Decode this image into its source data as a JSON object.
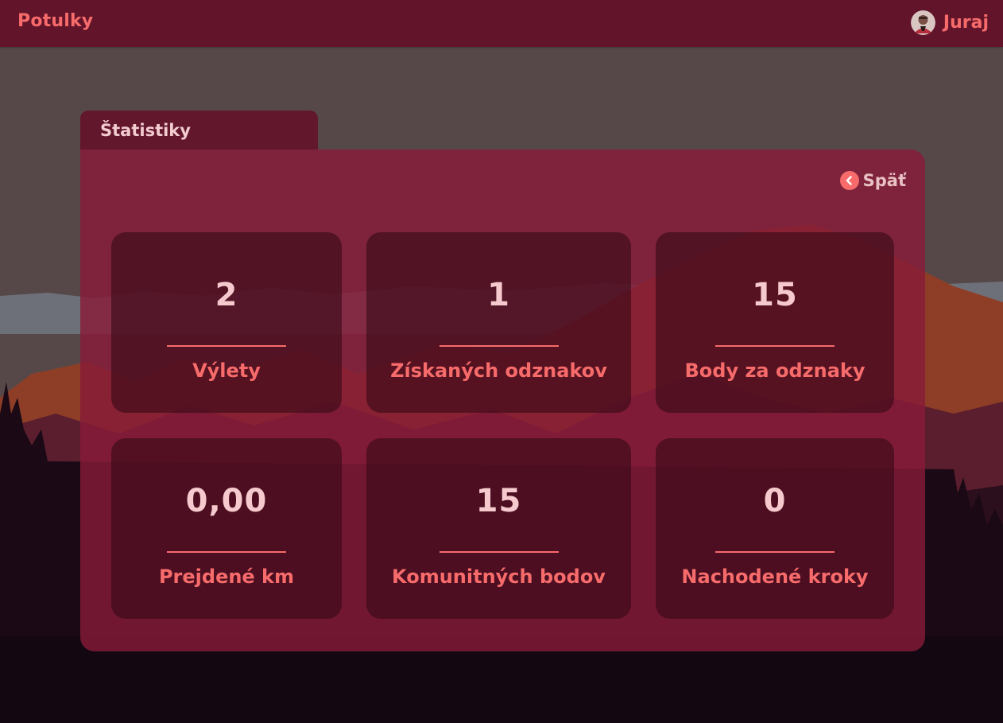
{
  "app": {
    "brand": "Potulky"
  },
  "user": {
    "name": "Juraj",
    "avatar_icon": "user-avatar-icon"
  },
  "section": {
    "title": "Štatistiky"
  },
  "back": {
    "label": "Späť",
    "icon": "chevron-left-icon"
  },
  "stats": [
    {
      "value": "2",
      "label": "Výlety"
    },
    {
      "value": "1",
      "label": "Získaných odznakov"
    },
    {
      "value": "15",
      "label": "Body za odznaky"
    },
    {
      "value": "0,00",
      "label": "Prejdené km"
    },
    {
      "value": "15",
      "label": "Komunitných bodov"
    },
    {
      "value": "0",
      "label": "Nachodené kroky"
    }
  ],
  "colors": {
    "accent": "#f76b6b",
    "topbar": "#62152a",
    "panel": "#881a38",
    "value_text": "#f5c9cd"
  }
}
